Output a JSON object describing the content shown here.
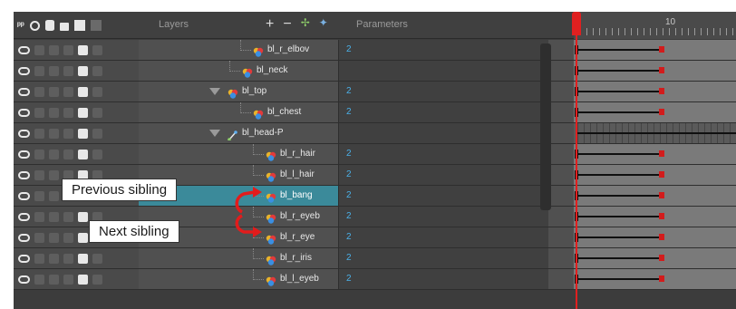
{
  "header": {
    "layers_label": "Layers",
    "parameters_label": "Parameters",
    "frame_number": "10"
  },
  "rows": [
    {
      "name": "bl_r_elbov",
      "param": "2",
      "kind": "drawing"
    },
    {
      "name": "bl_neck",
      "param": "",
      "kind": "drawing"
    },
    {
      "name": "bl_top",
      "param": "2",
      "kind": "drawing",
      "expanded": true
    },
    {
      "name": "bl_chest",
      "param": "2",
      "kind": "drawing"
    },
    {
      "name": "bl_head-P",
      "param": "",
      "kind": "peg",
      "expanded": true
    },
    {
      "name": "bl_r_hair",
      "param": "2",
      "kind": "drawing"
    },
    {
      "name": "bl_l_hair",
      "param": "2",
      "kind": "drawing"
    },
    {
      "name": "bl_bang",
      "param": "2",
      "kind": "drawing",
      "selected": true
    },
    {
      "name": "bl_r_eyeb",
      "param": "2",
      "kind": "drawing"
    },
    {
      "name": "bl_r_eye",
      "param": "2",
      "kind": "drawing"
    },
    {
      "name": "bl_r_iris",
      "param": "2",
      "kind": "drawing"
    },
    {
      "name": "bl_l_eyeb",
      "param": "2",
      "kind": "drawing"
    }
  ],
  "callouts": {
    "previous": "Previous sibling",
    "next": "Next sibling"
  },
  "colors": {
    "selected_row": "#3b8a9a",
    "param_value": "#4ab0e8",
    "keyframe": "#d21c1c",
    "playhead": "#e02020"
  }
}
